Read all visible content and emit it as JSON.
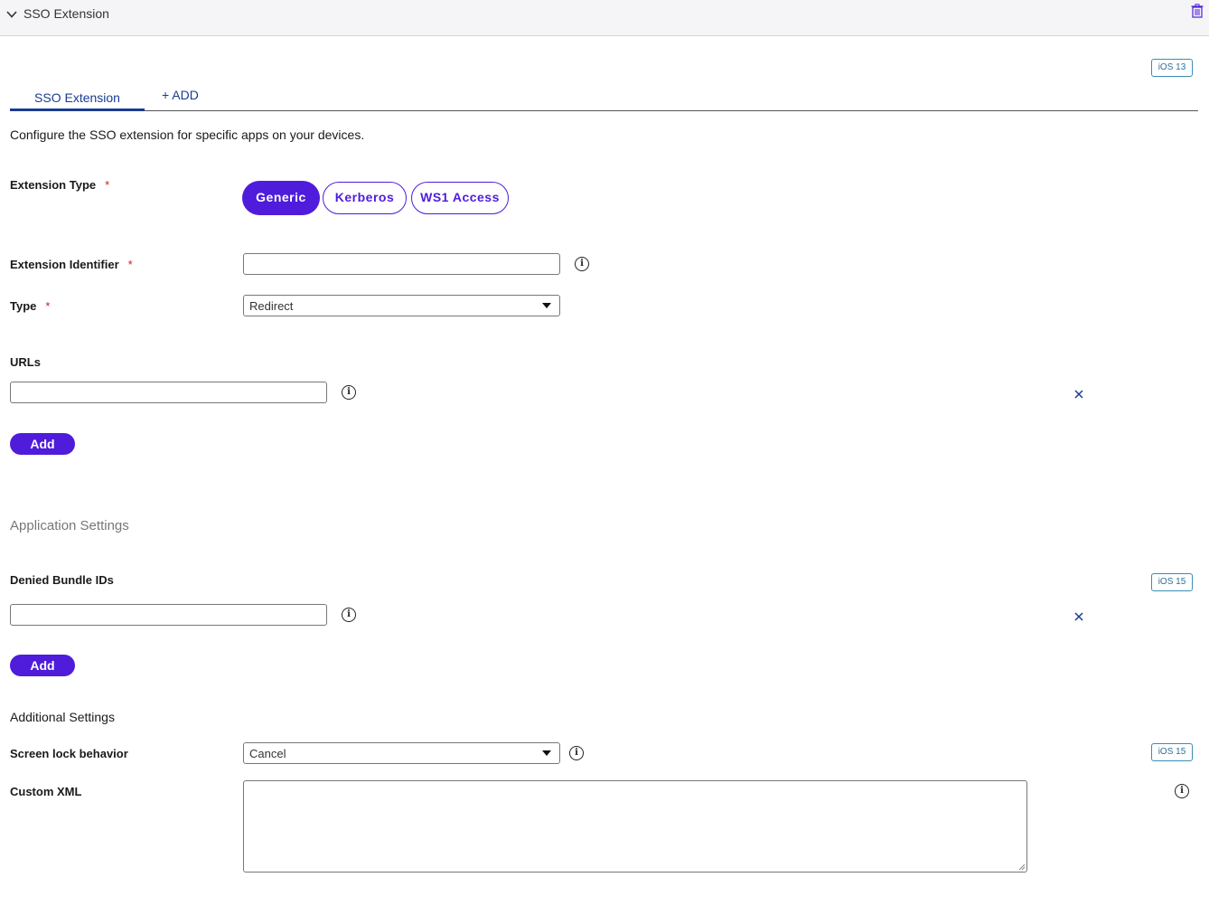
{
  "header": {
    "title": "SSO Extension"
  },
  "badges": {
    "ios13": "iOS 13",
    "ios15_denied": "iOS 15",
    "ios15_screenlock": "iOS 15"
  },
  "tabs": {
    "active": "SSO Extension",
    "add": "+ ADD"
  },
  "description": "Configure the SSO extension for specific apps on your devices.",
  "extension_type": {
    "label": "Extension Type",
    "required_mark": "*",
    "options": [
      "Generic",
      "Kerberos",
      "WS1 Access"
    ],
    "selected": "Generic"
  },
  "extension_identifier": {
    "label": "Extension Identifier",
    "required_mark": "*",
    "value": ""
  },
  "type": {
    "label": "Type",
    "required_mark": "*",
    "value": "Redirect"
  },
  "urls": {
    "label": "URLs",
    "value": "",
    "add_label": "Add"
  },
  "application_settings": {
    "title": "Application Settings",
    "denied_bundle_ids": {
      "label": "Denied Bundle IDs",
      "value": "",
      "add_label": "Add"
    }
  },
  "additional_settings": {
    "title": "Additional Settings",
    "screen_lock": {
      "label": "Screen lock behavior",
      "value": "Cancel"
    },
    "custom_xml": {
      "label": "Custom XML",
      "value": ""
    }
  },
  "colors": {
    "accent": "#4f1cdb",
    "link": "#1a3b8f",
    "required": "#c8202f",
    "badge_border": "#3a8cb8"
  },
  "icons": [
    "chevron-down-icon",
    "trash-icon",
    "info-icon",
    "close-icon",
    "caret-down-icon",
    "resize-grip-icon"
  ]
}
